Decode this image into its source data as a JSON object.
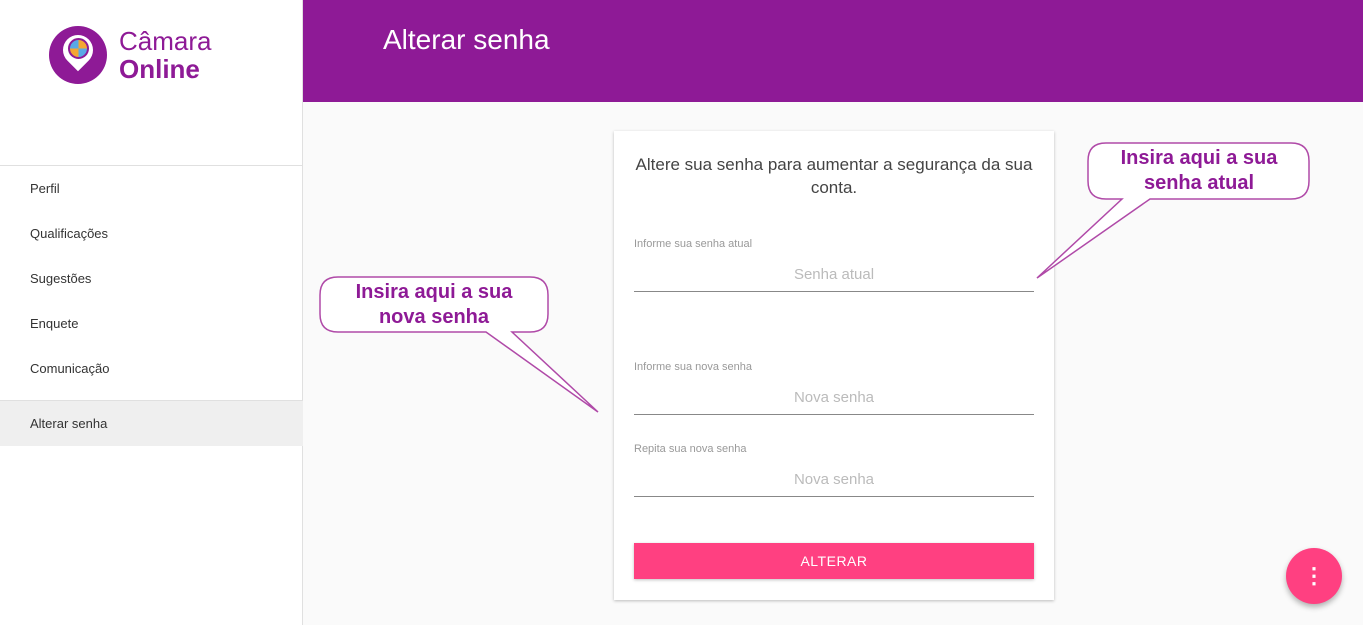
{
  "brand": {
    "line1": "Câmara",
    "line2": "Online",
    "color": "#8e1a96"
  },
  "header": {
    "title": "Alterar senha"
  },
  "sidebar": {
    "items": [
      {
        "label": "Perfil"
      },
      {
        "label": "Qualificações"
      },
      {
        "label": "Sugestões"
      },
      {
        "label": "Enquete"
      },
      {
        "label": "Comunicação"
      },
      {
        "label": "Alterar senha",
        "active": true
      }
    ]
  },
  "form": {
    "intro": "Altere sua senha para aumentar a segurança da sua conta.",
    "current": {
      "label": "Informe sua senha atual",
      "placeholder": "Senha atual"
    },
    "new": {
      "label": "Informe sua nova senha",
      "placeholder": "Nova senha"
    },
    "repeat": {
      "label": "Repita sua nova senha",
      "placeholder": "Nova senha"
    },
    "submit": "ALTERAR"
  },
  "callouts": {
    "current": {
      "line1": "Insira aqui a sua",
      "line2": "senha atual"
    },
    "new": {
      "line1": "Insira aqui a sua",
      "line2": "nova senha"
    }
  },
  "fab": {
    "icon": "more-vertical-icon",
    "glyph": "⋮",
    "color": "#ff4081"
  }
}
